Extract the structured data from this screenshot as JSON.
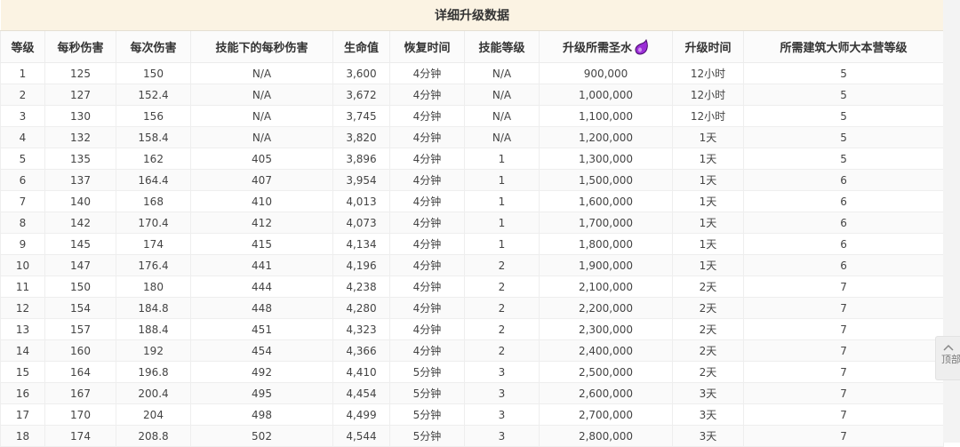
{
  "table": {
    "title": "详细升级数据",
    "headers": [
      "等级",
      "每秒伤害",
      "每次伤害",
      "技能下的每秒伤害",
      "生命值",
      "恢复时间",
      "技能等级",
      "升级所需圣水",
      "升级时间",
      "所需建筑大师大本营等级"
    ],
    "rows": [
      [
        "1",
        "125",
        "150",
        "N/A",
        "3,600",
        "4分钟",
        "N/A",
        "900,000",
        "12小时",
        "5"
      ],
      [
        "2",
        "127",
        "152.4",
        "N/A",
        "3,672",
        "4分钟",
        "N/A",
        "1,000,000",
        "12小时",
        "5"
      ],
      [
        "3",
        "130",
        "156",
        "N/A",
        "3,745",
        "4分钟",
        "N/A",
        "1,100,000",
        "12小时",
        "5"
      ],
      [
        "4",
        "132",
        "158.4",
        "N/A",
        "3,820",
        "4分钟",
        "N/A",
        "1,200,000",
        "1天",
        "5"
      ],
      [
        "5",
        "135",
        "162",
        "405",
        "3,896",
        "4分钟",
        "1",
        "1,300,000",
        "1天",
        "5"
      ],
      [
        "6",
        "137",
        "164.4",
        "407",
        "3,954",
        "4分钟",
        "1",
        "1,500,000",
        "1天",
        "6"
      ],
      [
        "7",
        "140",
        "168",
        "410",
        "4,013",
        "4分钟",
        "1",
        "1,600,000",
        "1天",
        "6"
      ],
      [
        "8",
        "142",
        "170.4",
        "412",
        "4,073",
        "4分钟",
        "1",
        "1,700,000",
        "1天",
        "6"
      ],
      [
        "9",
        "145",
        "174",
        "415",
        "4,134",
        "4分钟",
        "1",
        "1,800,000",
        "1天",
        "6"
      ],
      [
        "10",
        "147",
        "176.4",
        "441",
        "4,196",
        "4分钟",
        "2",
        "1,900,000",
        "1天",
        "6"
      ],
      [
        "11",
        "150",
        "180",
        "444",
        "4,238",
        "4分钟",
        "2",
        "2,100,000",
        "2天",
        "7"
      ],
      [
        "12",
        "154",
        "184.8",
        "448",
        "4,280",
        "4分钟",
        "2",
        "2,200,000",
        "2天",
        "7"
      ],
      [
        "13",
        "157",
        "188.4",
        "451",
        "4,323",
        "4分钟",
        "2",
        "2,300,000",
        "2天",
        "7"
      ],
      [
        "14",
        "160",
        "192",
        "454",
        "4,366",
        "4分钟",
        "2",
        "2,400,000",
        "2天",
        "7"
      ],
      [
        "15",
        "164",
        "196.8",
        "492",
        "4,410",
        "5分钟",
        "3",
        "2,500,000",
        "2天",
        "7"
      ],
      [
        "16",
        "167",
        "200.4",
        "495",
        "4,454",
        "5分钟",
        "3",
        "2,600,000",
        "3天",
        "7"
      ],
      [
        "17",
        "170",
        "204",
        "498",
        "4,499",
        "5分钟",
        "3",
        "2,700,000",
        "3天",
        "7"
      ],
      [
        "18",
        "174",
        "208.8",
        "502",
        "4,544",
        "5分钟",
        "3",
        "2,800,000",
        "3天",
        "7"
      ]
    ]
  },
  "icons": {
    "elixir": "elixir-drop-icon",
    "back_to_top": "chevron-up-icon"
  },
  "colors": {
    "title_bg": "#fbf3e3",
    "elixir": "#9b2fd6"
  },
  "back_to_top": {
    "label": "顶部"
  }
}
